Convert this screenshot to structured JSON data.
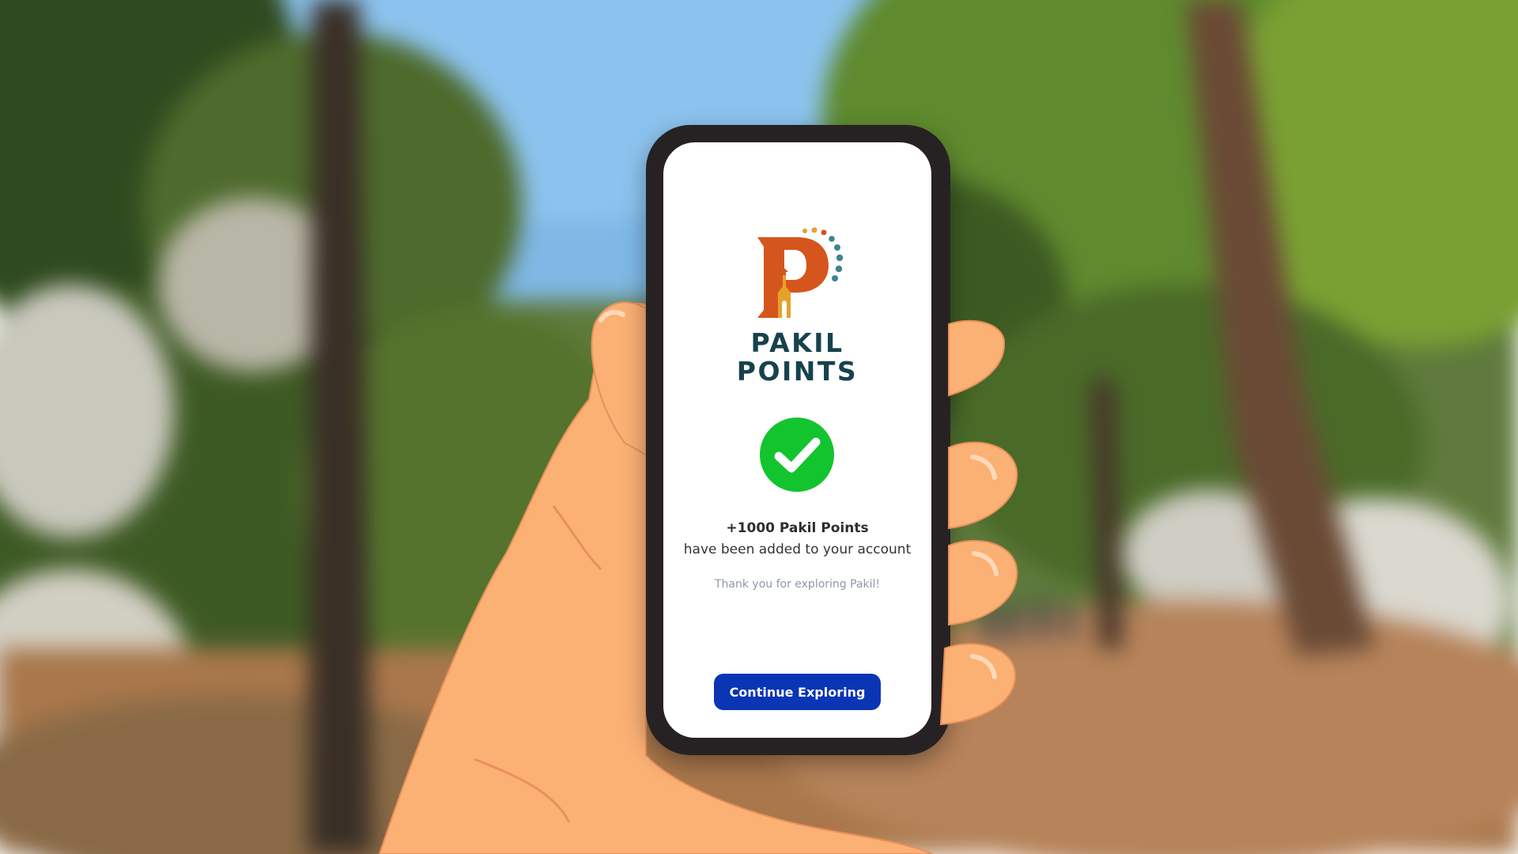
{
  "app": {
    "brand_line1": "PAKIL",
    "brand_line2": "POINTS"
  },
  "confirmation": {
    "points_text": "+1000 Pakil Points",
    "subtitle": "have been added to your account",
    "thanks": "Thank you for exploring Pakil!"
  },
  "actions": {
    "continue_label": "Continue Exploring"
  },
  "icons": {
    "logo": "pakil-church-p-logo",
    "status": "success-check-icon"
  },
  "colors": {
    "brand_navy": "#17424d",
    "brand_orange": "#d5561c",
    "brand_gold": "#e6a12b",
    "success_green": "#12c42e",
    "button_blue": "#0a35b5"
  }
}
